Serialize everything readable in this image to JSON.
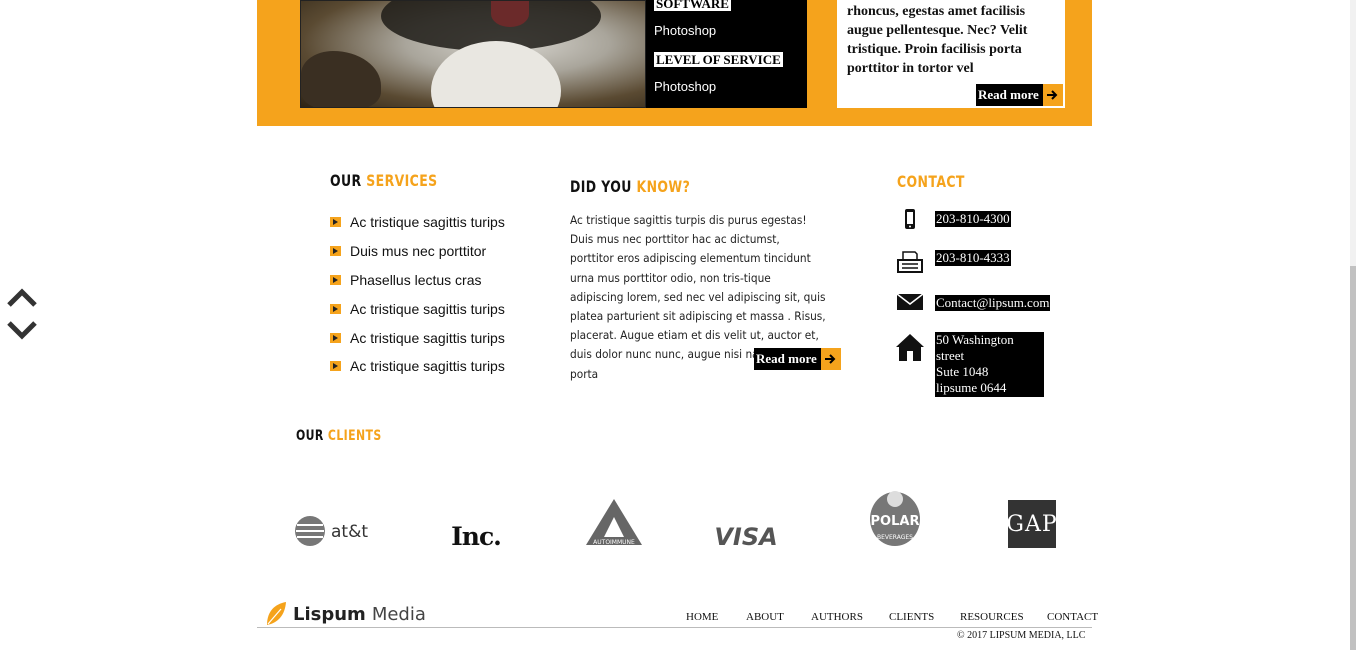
{
  "hero": {
    "info": {
      "label_software": "SOFTWARE",
      "value_software": "Photoshop",
      "label_service": "LEVEL OF SERVICE",
      "value_service": "Photoshop"
    },
    "card": {
      "text": "rhoncus, egestas amet facilisis augue pellentesque. Nec? Velit tristique. Proin facilisis porta porttitor in tortor vel",
      "read_more": "Read more"
    }
  },
  "services": {
    "heading_dark": "OUR",
    "heading_orange": "SERVICES",
    "items": [
      "Ac tristique sagittis turips",
      "Duis mus nec porttitor",
      "Phasellus lectus cras",
      "Ac tristique sagittis turips",
      "Ac tristique sagittis turips",
      "Ac tristique sagittis turips"
    ]
  },
  "know": {
    "heading_dark": "DID YOU",
    "heading_orange": "KNOW?",
    "text": "Ac tristique sagittis turpis dis purus egestas! Duis mus nec porttitor hac ac dictumst, porttitor eros adipiscing elementum tincidunt urna mus porttitor odio, non tris-tique adipiscing lorem, sed nec vel adipiscing sit, quis platea parturient sit adipiscing et massa . Risus, placerat. Augue etiam et dis velit ut, auctor et, duis dolor nunc nunc, augue nisi nascetur, porta",
    "read_more": "Read more"
  },
  "contact": {
    "heading": "CONTACT",
    "phone": "203-810-4300",
    "fax": "203-810-4333",
    "email": "Contact@lipsum.com",
    "address": [
      "50 Washington street",
      "Sute 1048",
      "lipsume 0644"
    ]
  },
  "clients": {
    "heading_dark": "OUR",
    "heading_orange": "CLIENTS",
    "logos": {
      "att": "at&t",
      "inc": "Inc.",
      "autoimmune": "AUTOIMMUNE",
      "visa": "VISA",
      "polar": "POLAR",
      "polar_sub": "BEVERAGES",
      "gap": "GAP"
    }
  },
  "footer": {
    "brand_bold": "Lispum",
    "brand_light": "Media",
    "nav": [
      "HOME",
      "ABOUT",
      "AUTHORS",
      "CLIENTS",
      "RESOURCES",
      "CONTACT"
    ],
    "copyright": "© 2017 LIPSUM MEDIA, LLC"
  },
  "colors": {
    "accent": "#f5a31c",
    "dark": "#000000"
  },
  "icons": [
    "chevron-up-icon",
    "chevron-down-icon",
    "phone-icon",
    "fax-icon",
    "mail-icon",
    "home-icon",
    "arrow-right-icon",
    "leaf-icon"
  ]
}
